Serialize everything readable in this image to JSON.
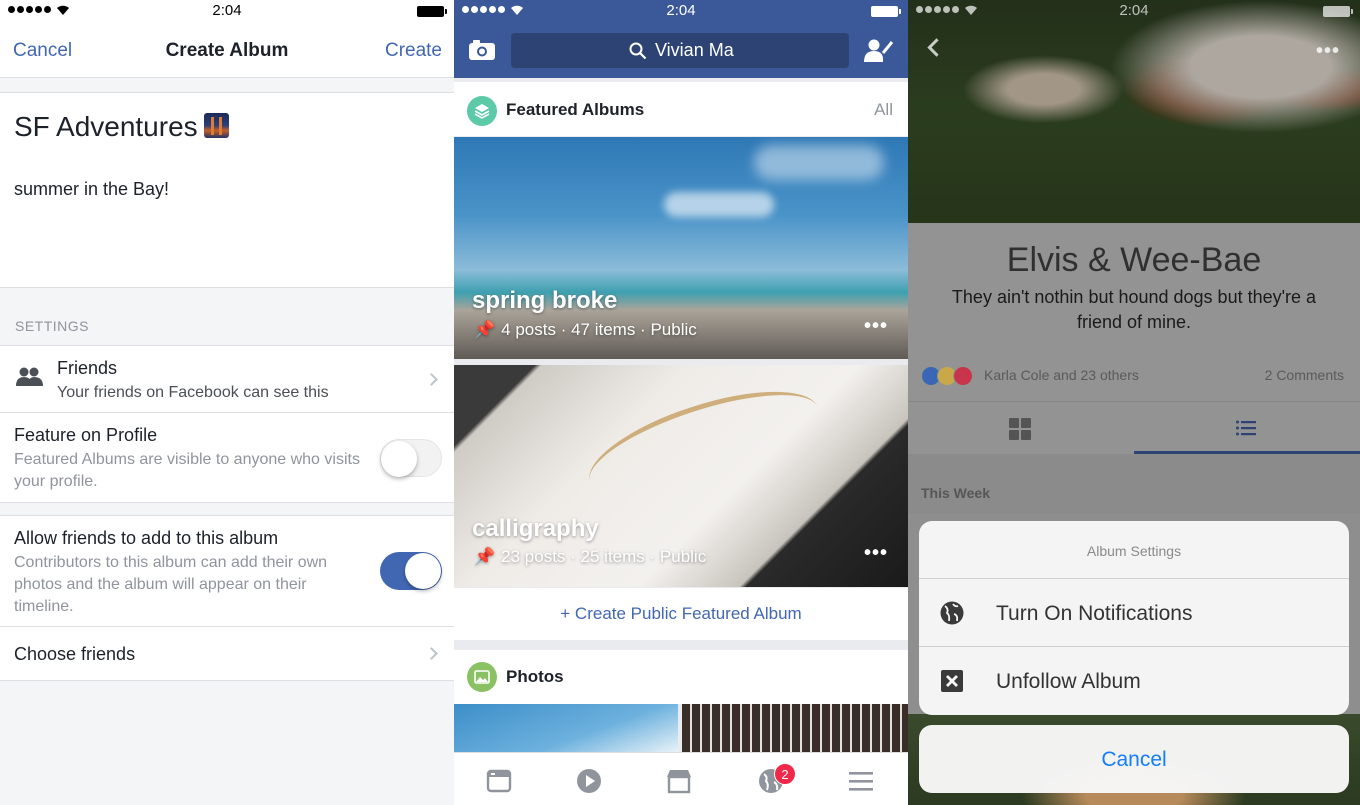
{
  "status_bar": {
    "time": "2:04"
  },
  "create_album": {
    "nav": {
      "cancel": "Cancel",
      "title": "Create Album",
      "create": "Create"
    },
    "album_name": "SF Adventures",
    "album_name_emoji": "bridge-at-night",
    "description": "summer in the Bay!",
    "settings_header": "SETTINGS",
    "privacy": {
      "title": "Friends",
      "subtitle": "Your friends on Facebook can see this"
    },
    "feature_on_profile": {
      "title": "Feature on Profile",
      "subtitle": "Featured Albums are visible to anyone who visits your profile.",
      "enabled": false
    },
    "allow_friends": {
      "title": "Allow friends to add to this album",
      "subtitle": "Contributors to this album can add their own photos and the album will appear on their timeline.",
      "enabled": true
    },
    "choose_friends": "Choose friends"
  },
  "profile": {
    "search_value": "Vivian Ma",
    "featured": {
      "title": "Featured Albums",
      "all": "All"
    },
    "albums": [
      {
        "title": "spring broke",
        "meta": "4 posts · 47 items · Public"
      },
      {
        "title": "calligraphy",
        "meta": "23 posts · 25 items · Public"
      }
    ],
    "create_featured": "+ Create Public Featured Album",
    "photos": {
      "title": "Photos"
    },
    "bottom_tabs": [
      {
        "icon": "news-feed-icon"
      },
      {
        "icon": "video-icon"
      },
      {
        "icon": "marketplace-icon"
      },
      {
        "icon": "notifications-globe-icon",
        "badge": "2"
      },
      {
        "icon": "menu-icon"
      }
    ]
  },
  "shared_album": {
    "title": "Elvis & Wee-Bae",
    "description": "They ain't nothin but hound dogs but they're a friend of mine.",
    "reactions": "Karla Cole and 23 others",
    "comments": "2 Comments",
    "section": "This Week",
    "sheet": {
      "title": "Album Settings",
      "options": [
        {
          "label": "Turn On Notifications",
          "icon": "globe-icon"
        },
        {
          "label": "Unfollow Album",
          "icon": "close-box-icon"
        }
      ],
      "cancel": "Cancel"
    }
  },
  "colors": {
    "facebook_blue": "#3b5998",
    "link_blue": "#4267b2",
    "ios_blue": "#147efb",
    "badge_red": "#f02849",
    "featured_teal": "#5cc9a7",
    "photos_green": "#8ac164"
  }
}
